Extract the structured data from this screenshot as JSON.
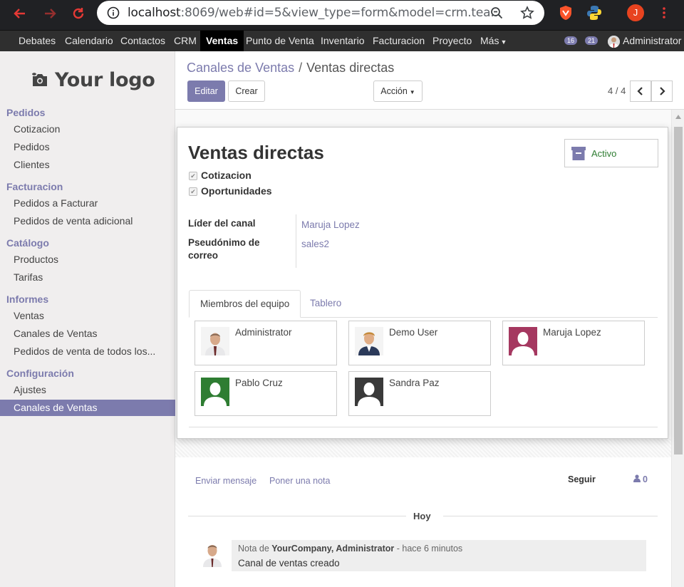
{
  "browser": {
    "url_host": "localhost",
    "url_rest": ":8069/web#id=5&view_type=form&model=crm.tea..."
  },
  "topbar": {
    "menus": [
      "Debates",
      "Calendario",
      "Contactos",
      "CRM",
      "Ventas",
      "Punto de Venta",
      "Inventario",
      "Facturacion",
      "Proyecto",
      "Más"
    ],
    "active_menu": "Ventas",
    "badge_messages": "16",
    "badge_chat": "21",
    "user": "Administrator",
    "browser_user_initial": "J"
  },
  "sidebar": {
    "logo_text": "Your logo",
    "sections": [
      {
        "title": "Pedidos",
        "items": [
          "Cotizacion",
          "Pedidos",
          "Clientes"
        ]
      },
      {
        "title": "Facturacion",
        "items": [
          "Pedidos a Facturar",
          "Pedidos de venta adicional"
        ]
      },
      {
        "title": "Catálogo",
        "items": [
          "Productos",
          "Tarifas"
        ]
      },
      {
        "title": "Informes",
        "items": [
          "Ventas",
          "Canales de Ventas",
          "Pedidos de venta de todos los..."
        ]
      },
      {
        "title": "Configuración",
        "items": [
          "Ajustes",
          "Canales de Ventas"
        ]
      }
    ],
    "active_item": "Canales de Ventas"
  },
  "control_panel": {
    "breadcrumb_parent": "Canales de Ventas",
    "breadcrumb_sep": "/",
    "breadcrumb_current": "Ventas directas",
    "edit_label": "Editar",
    "create_label": "Crear",
    "action_label": "Acción",
    "pager": "4 / 4"
  },
  "form": {
    "title": "Ventas directas",
    "status_button": "Activo",
    "checkboxes": [
      {
        "label": "Cotizacion",
        "checked": true
      },
      {
        "label": "Oportunidades",
        "checked": true
      }
    ],
    "fields": {
      "leader_label": "Líder del canal",
      "leader_value": "Maruja Lopez",
      "alias_label_1": "Pseudónimo de",
      "alias_label_2": "correo",
      "alias_value": "sales2"
    },
    "tabs": [
      "Miembros del equipo",
      "Tablero"
    ],
    "active_tab": "Miembros del equipo",
    "members": [
      {
        "name": "Administrator",
        "avatar": "photo-icon"
      },
      {
        "name": "Demo User",
        "avatar": "photo-icon"
      },
      {
        "name": "Maruja Lopez",
        "avatar": "placeholder-icon",
        "color": "#a53860"
      },
      {
        "name": "Pablo Cruz",
        "avatar": "placeholder-icon",
        "color": "#2e7d32"
      },
      {
        "name": "Sandra Paz",
        "avatar": "placeholder-icon",
        "color": "#3a3a3a"
      }
    ]
  },
  "chatter": {
    "send_message": "Enviar mensaje",
    "log_note": "Poner una nota",
    "follow": "Seguir",
    "followers": "0",
    "date_separator": "Hoy",
    "message": {
      "prefix": "Nota de",
      "author": "YourCompany, Administrator",
      "time": "- hace 6 minutos",
      "body": "Canal de ventas creado"
    }
  },
  "colors": {
    "accent": "#7c7bad",
    "topbar": "#2f2f2f",
    "browser": "#202124"
  }
}
